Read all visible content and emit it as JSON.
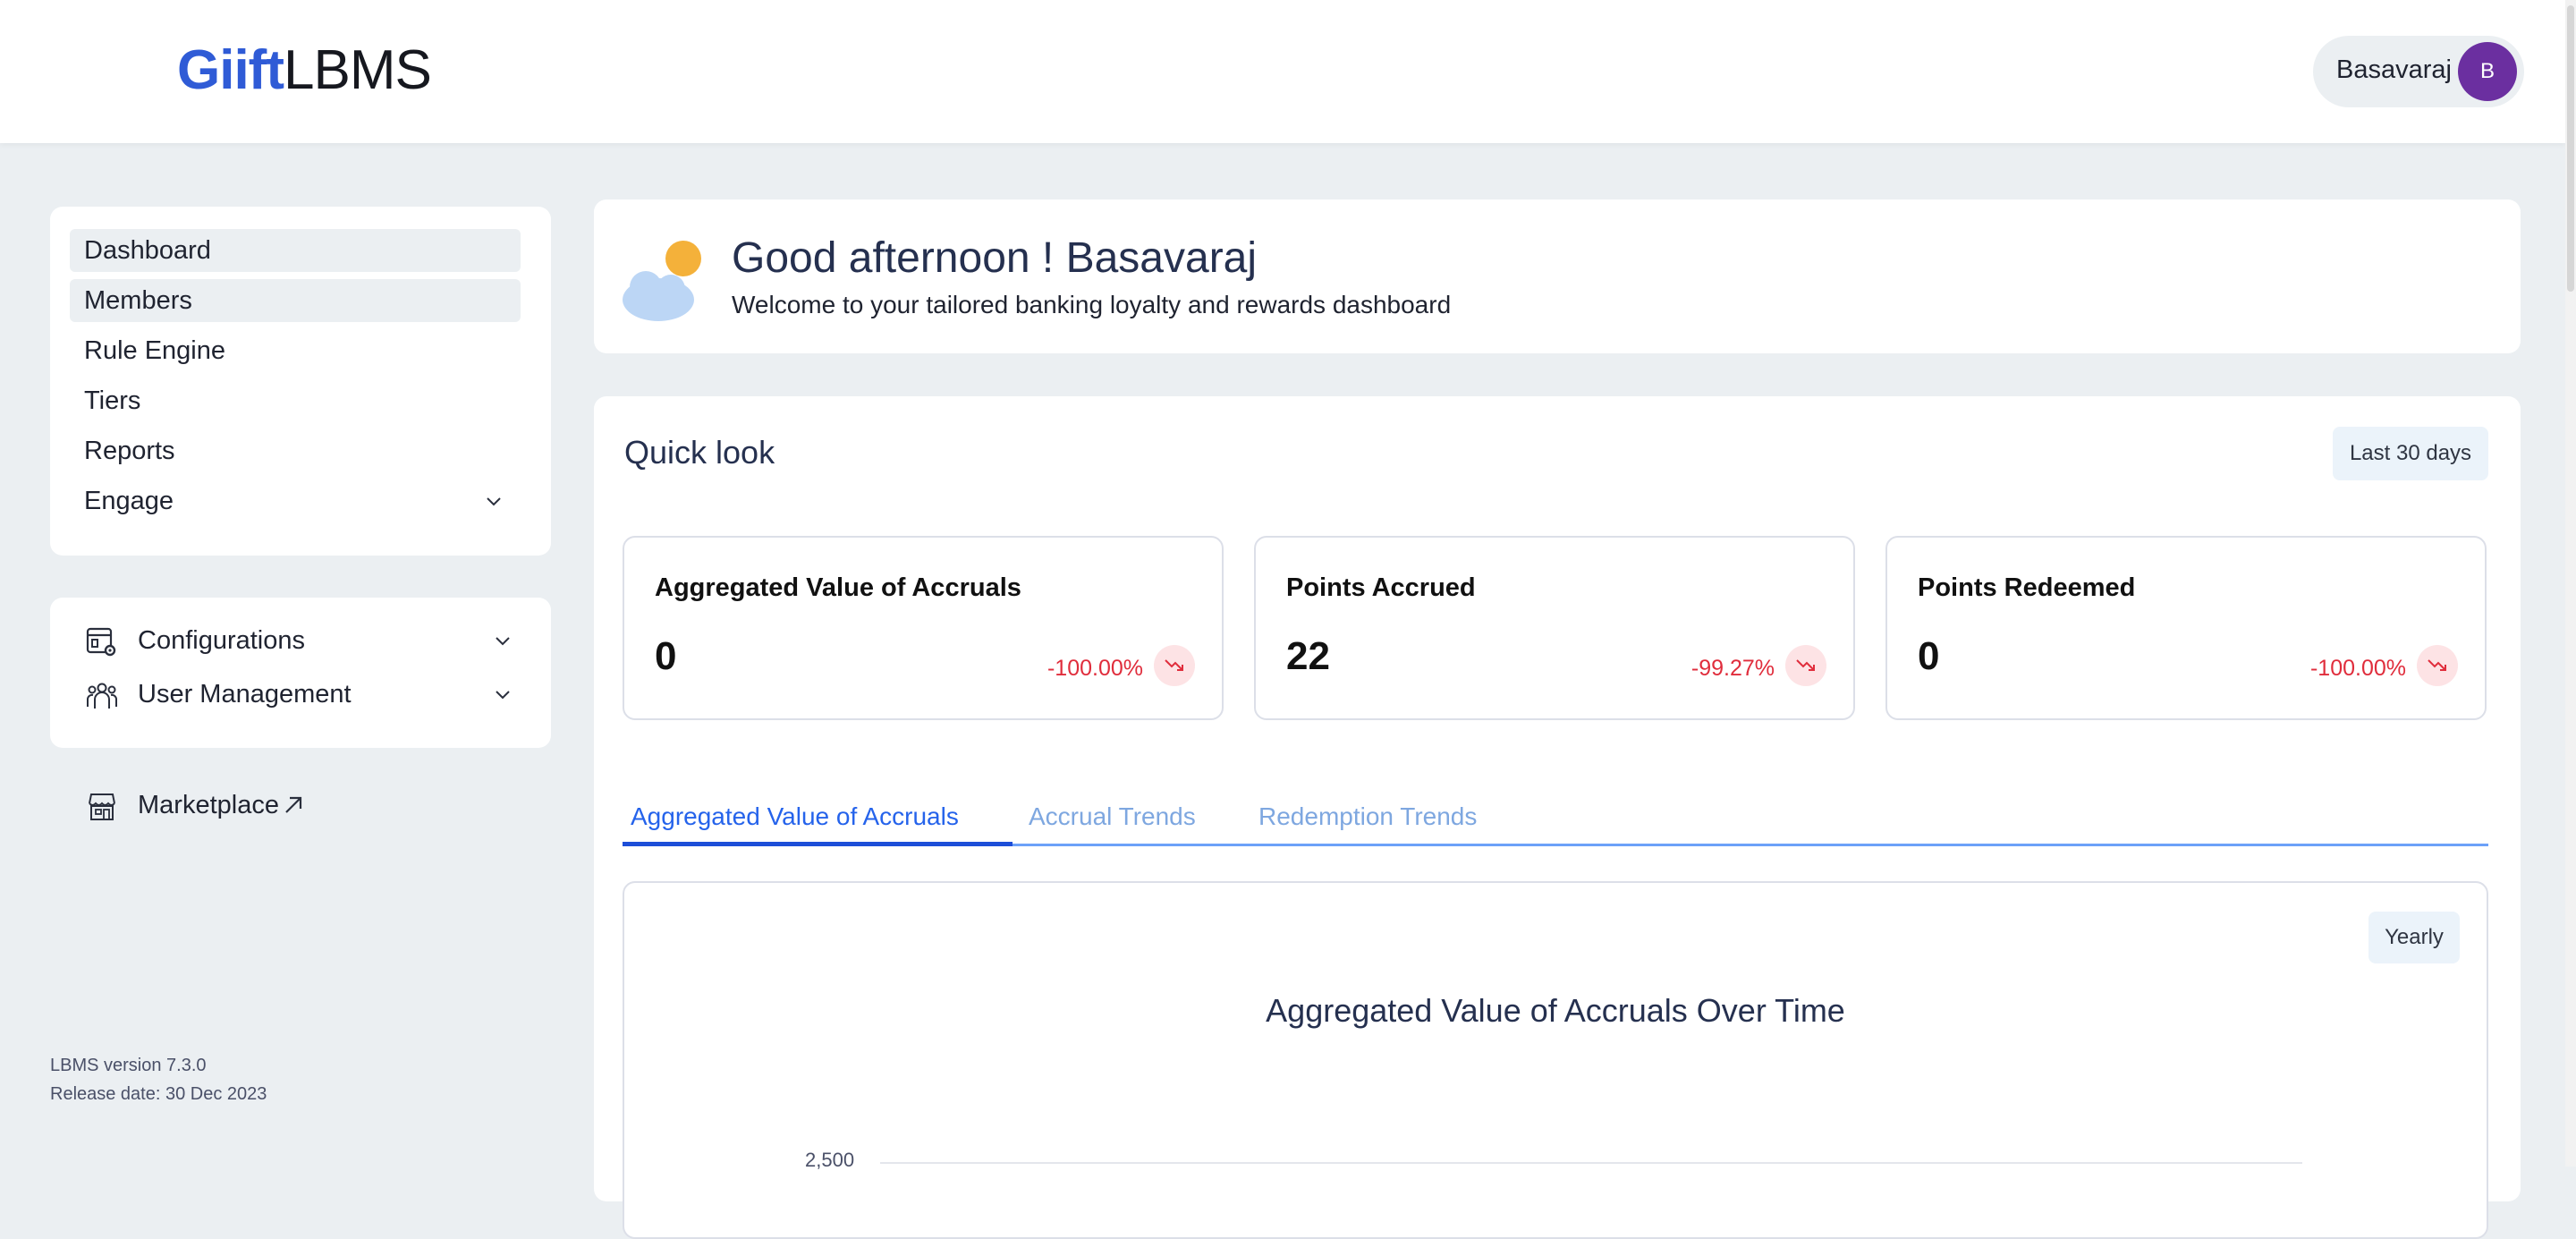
{
  "header": {
    "logo_brand": "Giift",
    "logo_product": "LBMS",
    "user_name": "Basavaraj",
    "user_initial": "B"
  },
  "sidebar": {
    "nav_items": [
      {
        "label": "Dashboard",
        "active": true
      },
      {
        "label": "Members",
        "active": true
      },
      {
        "label": "Rule Engine",
        "active": false
      },
      {
        "label": "Tiers",
        "active": false
      },
      {
        "label": "Reports",
        "active": false
      },
      {
        "label": "Engage",
        "active": false,
        "expandable": true
      }
    ],
    "config_items": [
      {
        "label": "Configurations",
        "icon": "settings-panel-icon"
      },
      {
        "label": "User Management",
        "icon": "users-icon"
      }
    ],
    "marketplace_label": "Marketplace",
    "version": "LBMS version 7.3.0",
    "release_date": "Release date: 30 Dec 2023"
  },
  "welcome": {
    "title": "Good afternoon ! Basavaraj",
    "subtitle": "Welcome to your tailored banking loyalty and rewards dashboard",
    "icon": "partly-sunny-icon"
  },
  "quick_look": {
    "title": "Quick look",
    "range_label": "Last 30 days",
    "metrics": [
      {
        "label": "Aggregated Value of Accruals",
        "value": "0",
        "change": "-100.00%"
      },
      {
        "label": "Points Accrued",
        "value": "22",
        "change": "-99.27%"
      },
      {
        "label": "Points Redeemed",
        "value": "0",
        "change": "-100.00%"
      }
    ],
    "tabs": [
      {
        "label": "Aggregated Value of Accruals",
        "active": true
      },
      {
        "label": "Accrual Trends",
        "active": false
      },
      {
        "label": "Redemption Trends",
        "active": false
      }
    ],
    "chart": {
      "period_label": "Yearly",
      "title": "Aggregated Value of Accruals Over Time",
      "visible_ytick": "2,500"
    }
  },
  "colors": {
    "brand": "#2f5bd6",
    "accent": "#2563eb",
    "negative": "#e02d3c",
    "avatar": "#6b2fa0",
    "background": "#ebeff2"
  }
}
